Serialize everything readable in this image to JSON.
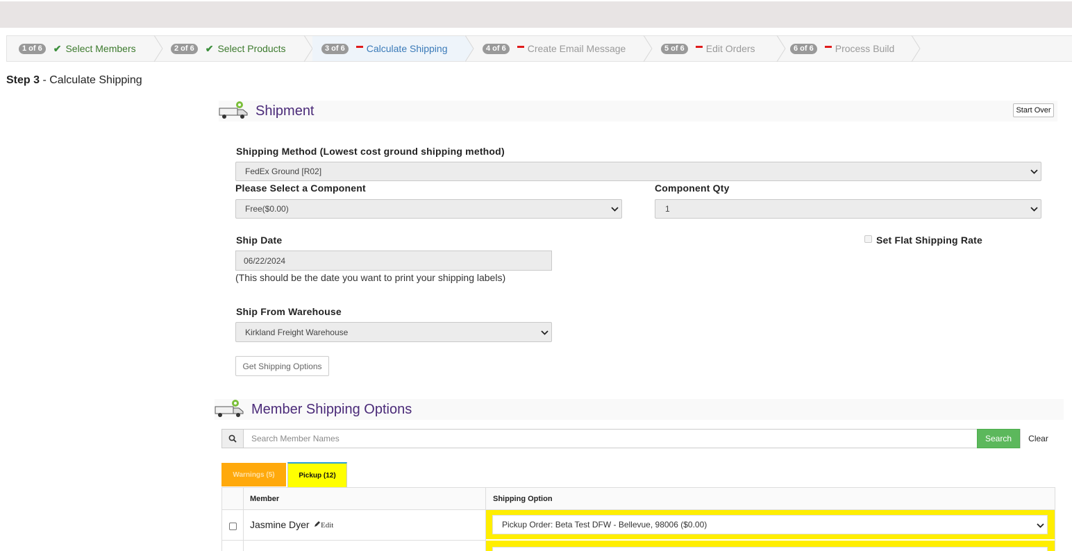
{
  "wizard": {
    "steps": [
      {
        "badge": "1 of 6",
        "label": "Select Members",
        "state": "done"
      },
      {
        "badge": "2 of 6",
        "label": "Select Products",
        "state": "done"
      },
      {
        "badge": "3 of 6",
        "label": "Calculate Shipping",
        "state": "current"
      },
      {
        "badge": "4 of 6",
        "label": "Create Email Message",
        "state": "todo"
      },
      {
        "badge": "5 of 6",
        "label": "Edit Orders",
        "state": "todo"
      },
      {
        "badge": "6 of 6",
        "label": "Process Build",
        "state": "todo"
      }
    ],
    "check_mark": "✔"
  },
  "step_title": {
    "prefix": "Step 3",
    "rest": " - Calculate Shipping"
  },
  "shipment": {
    "title": "Shipment",
    "start_over": "Start Over",
    "shipping_method_label": "Shipping Method (Lowest cost ground shipping method)",
    "shipping_method_value": "FedEx Ground [R02]",
    "component_label": "Please Select a Component",
    "component_value": "Free($0.00)",
    "component_qty_label": "Component Qty",
    "component_qty_value": "1",
    "ship_date_label": "Ship Date",
    "ship_date_value": "06/22/2024",
    "ship_date_hint": "(This should be the date you want to print your shipping labels)",
    "flat_rate_label": "Set Flat Shipping Rate",
    "warehouse_label": "Ship From Warehouse",
    "warehouse_value": "Kirkland Freight Warehouse",
    "get_options_button": "Get Shipping Options"
  },
  "member_options": {
    "title": "Member Shipping Options",
    "search_placeholder": "Search Member Names",
    "search_button": "Search",
    "clear_button": "Clear",
    "tabs": [
      {
        "label": "Warnings (5)",
        "color": "#ffa500"
      },
      {
        "label": "Pickup (12)",
        "color": "#ffff00"
      }
    ],
    "columns": [
      "Member",
      "Shipping Option"
    ],
    "rows": [
      {
        "member": "Jasmine Dyer",
        "edit": "Edit",
        "shipping_option": "Pickup Order: Beta Test DFW - Bellevue, 98006 ($0.00)"
      }
    ]
  },
  "colors": {
    "accent_purple": "#4a2a78",
    "success_green": "#5cb85c",
    "highlight_yellow": "#ffee00"
  }
}
